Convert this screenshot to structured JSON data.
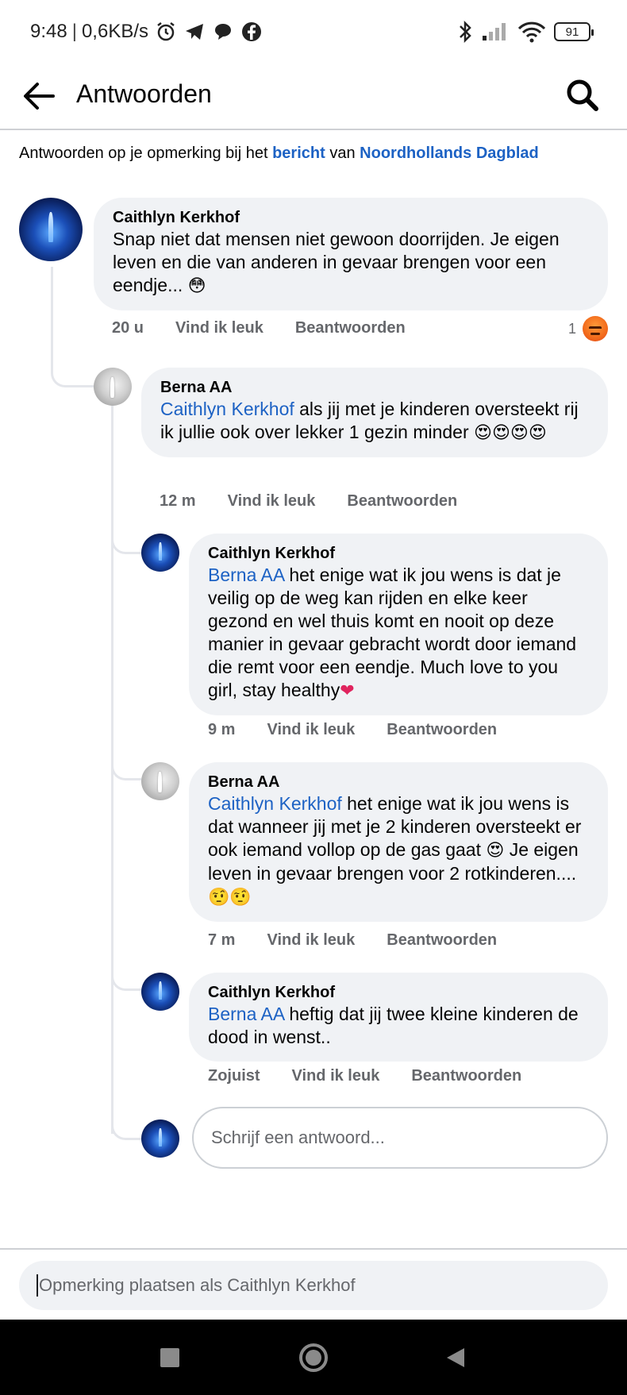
{
  "status_bar": {
    "time": "9:48",
    "net_speed": "0,6KB/s",
    "battery": "91"
  },
  "header": {
    "title": "Antwoorden"
  },
  "context": {
    "prefix": "Antwoorden op je opmerking bij het",
    "link_post": "bericht",
    "middle": "van",
    "link_page": "Noordhollands Dagblad"
  },
  "comments": [
    {
      "author": "Caithlyn Kerkhof",
      "mention": "",
      "text": "Snap niet dat mensen niet gewoon doorrijden. Je eigen leven en die van anderen in gevaar brengen voor een eendje...",
      "emoji": "😳",
      "time": "20 u",
      "like": "Vind ik leuk",
      "reply": "Beantwoorden",
      "reaction_count": "1"
    },
    {
      "author": "Berna AA",
      "mention": "Caithlyn Kerkhof",
      "text": "als jij met je kinderen oversteekt rij ik jullie ook over lekker 1 gezin minder",
      "emoji": "😍😍😍😍",
      "time": "12 m",
      "like": "Vind ik leuk",
      "reply": "Beantwoorden"
    },
    {
      "author": "Caithlyn Kerkhof",
      "mention": "Berna AA",
      "text": "het enige wat ik jou wens is dat je veilig op de weg kan rijden en elke keer gezond en wel thuis komt en nooit op deze manier in gevaar gebracht wordt door iemand die remt voor een eendje. Much love to you girl, stay healthy",
      "emoji": "❤",
      "time": "9 m",
      "like": "Vind ik leuk",
      "reply": "Beantwoorden"
    },
    {
      "author": "Berna AA",
      "mention": "Caithlyn Kerkhof",
      "text": "het enige wat ik jou wens is dat wanneer jij met je 2 kinderen oversteekt er ook iemand vollop op de gas gaat",
      "emoji": "😍",
      "text2": "Je eigen leven in gevaar brengen voor 2 rotkinderen....",
      "emoji2": "🤨🤨",
      "time": "7 m",
      "like": "Vind ik leuk",
      "reply": "Beantwoorden"
    },
    {
      "author": "Caithlyn Kerkhof",
      "mention": "Berna AA",
      "text": "heftig dat jij twee kleine kinderen de dood in wenst..",
      "emoji": "",
      "time": "Zojuist",
      "like": "Vind ik leuk",
      "reply": "Beantwoorden"
    }
  ],
  "reply_input": {
    "placeholder": "Schrijf een antwoord..."
  },
  "composer": {
    "placeholder": "Opmerking plaatsen als Caithlyn Kerkhof"
  },
  "colors": {
    "link": "#1d62c4",
    "bubble": "#f0f2f5",
    "meta": "#65676b"
  }
}
